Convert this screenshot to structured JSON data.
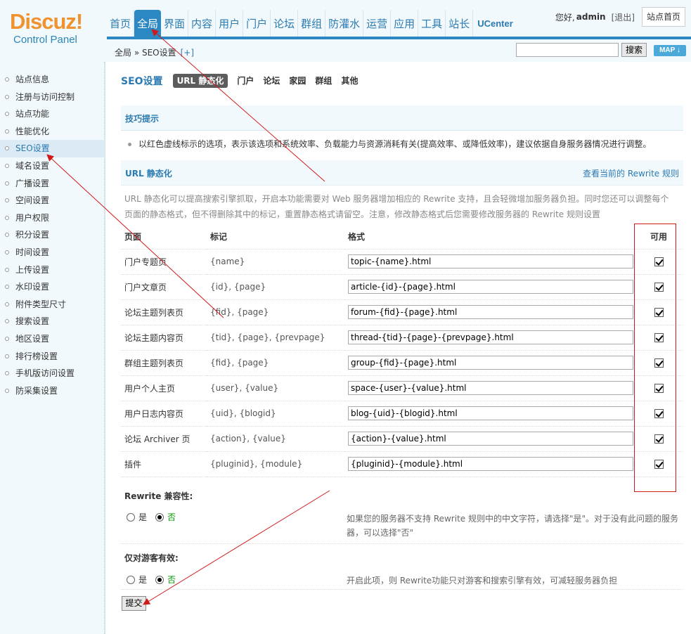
{
  "header": {
    "logo_text": "Discuz!",
    "logo_sub": "Control Panel",
    "nav": [
      "首页",
      "全局",
      "界面",
      "内容",
      "用户",
      "门户",
      "论坛",
      "群组",
      "防灌水",
      "运营",
      "应用",
      "工具",
      "站长",
      "UCenter"
    ],
    "nav_active": "全局",
    "greeting": "您好,",
    "username": "admin",
    "logout": "[退出]",
    "site_home": "站点首页",
    "breadcrumb": "全局 » SEO设置",
    "breadcrumb_plus": "[+]",
    "search_placeholder": "",
    "search_button": "搜索",
    "map_button": "MAP ↓"
  },
  "sidebar": {
    "items": [
      "站点信息",
      "注册与访问控制",
      "站点功能",
      "性能优化",
      "SEO设置",
      "域名设置",
      "广播设置",
      "空间设置",
      "用户权限",
      "积分设置",
      "时间设置",
      "上传设置",
      "水印设置",
      "附件类型尺寸",
      "搜索设置",
      "地区设置",
      "排行榜设置",
      "手机版访问设置",
      "防采集设置"
    ],
    "active": "SEO设置"
  },
  "main": {
    "title": "SEO设置",
    "tabs": [
      "URL 静态化",
      "门户",
      "论坛",
      "家园",
      "群组",
      "其他"
    ],
    "tab_active": "URL 静态化",
    "tip_title": "技巧提示",
    "tip_text": "以红色虚线标示的选项，表示该选项和系统效率、负载能力与资源消耗有关(提高效率、或降低效率)，建议依据自身服务器情况进行调整。",
    "url_title": "URL 静态化",
    "url_link": "查看当前的 Rewrite 规则",
    "url_desc": "URL 静态化可以提高搜索引擎抓取，开启本功能需要对 Web 服务器增加相应的 Rewrite 支持，且会轻微增加服务器负担。同时您还可以调整每个页面的静态格式，但不得删除其中的标记，重置静态格式请留空。注意，修改静态格式后您需要修改服务器的 Rewrite 规则设置",
    "table_headers": {
      "page": "页面",
      "mark": "标记",
      "format": "格式",
      "avail": "可用"
    },
    "rows": [
      {
        "page": "门户专题页",
        "mark": "{name}",
        "format": "topic-{name}.html",
        "enabled": true
      },
      {
        "page": "门户文章页",
        "mark": "{id}, {page}",
        "format": "article-{id}-{page}.html",
        "enabled": true
      },
      {
        "page": "论坛主题列表页",
        "mark": "{fid}, {page}",
        "format": "forum-{fid}-{page}.html",
        "enabled": true
      },
      {
        "page": "论坛主题内容页",
        "mark": "{tid}, {page}, {prevpage}",
        "format": "thread-{tid}-{page}-{prevpage}.html",
        "enabled": true
      },
      {
        "page": "群组主题列表页",
        "mark": "{fid}, {page}",
        "format": "group-{fid}-{page}.html",
        "enabled": true
      },
      {
        "page": "用户个人主页",
        "mark": "{user}, {value}",
        "format": "space-{user}-{value}.html",
        "enabled": true
      },
      {
        "page": "用户日志内容页",
        "mark": "{uid}, {blogid}",
        "format": "blog-{uid}-{blogid}.html",
        "enabled": true
      },
      {
        "page": "论坛 Archiver 页",
        "mark": "{action}, {value}",
        "format": "{action}-{value}.html",
        "enabled": true
      },
      {
        "page": "插件",
        "mark": "{pluginid}, {module}",
        "format": "{pluginid}-{module}.html",
        "enabled": true
      }
    ],
    "rewrite_compat": {
      "title": "Rewrite 兼容性:",
      "yes": "是",
      "no": "否",
      "selected": "否",
      "desc": "如果您的服务器不支持 Rewrite 规则中的中文字符，请选择\"是\"。对于没有此问题的服务器，可以选择\"否\""
    },
    "guest_only": {
      "title": "仅对游客有效:",
      "yes": "是",
      "no": "否",
      "selected": "否",
      "desc": "开启此项，则 Rewrite功能只对游客和搜索引擎有效，可减轻服务器负担"
    },
    "submit": "提交"
  },
  "colors": {
    "accent": "#2b88c3",
    "link": "#2b7ab0",
    "logo": "#f0922d",
    "annotation": "#d01a1a"
  }
}
